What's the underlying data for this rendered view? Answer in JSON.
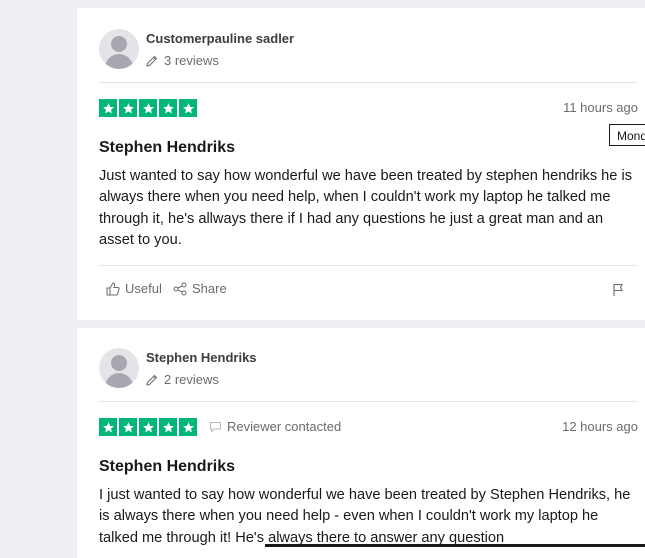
{
  "tooltip": {
    "text": "Mond"
  },
  "reviews": [
    {
      "author": "Customerpauline sadler",
      "review_count": "3 reviews",
      "rating": 5,
      "date": "11 hours ago",
      "title": "Stephen Hendriks",
      "body": "Just wanted to say how wonderful we have been treated by stephen hendriks he is always there when you need help, when I couldn't work my laptop he talked me through it, he's allways there if I had any questions he just a great man and an asset to you.",
      "actions": {
        "useful": "Useful",
        "share": "Share"
      }
    },
    {
      "author": "Stephen Hendriks",
      "review_count": "2 reviews",
      "rating": 5,
      "reviewer_contacted": "Reviewer contacted",
      "date": "12 hours ago",
      "title": "Stephen Hendriks",
      "body": "I just wanted to say how wonderful we have been treated by Stephen Hendriks, he is always there when you need help - even when I couldn't work my laptop he talked me through it! He's always there to answer any question"
    }
  ],
  "colors": {
    "star_green": "#00b67a",
    "page_bg": "#efeff3",
    "card_bg": "#ffffff"
  },
  "icons": [
    "avatar-placeholder",
    "pencil-icon",
    "star-icon",
    "thumbs-up-icon",
    "share-icon",
    "flag-icon",
    "chat-bubble-icon"
  ]
}
